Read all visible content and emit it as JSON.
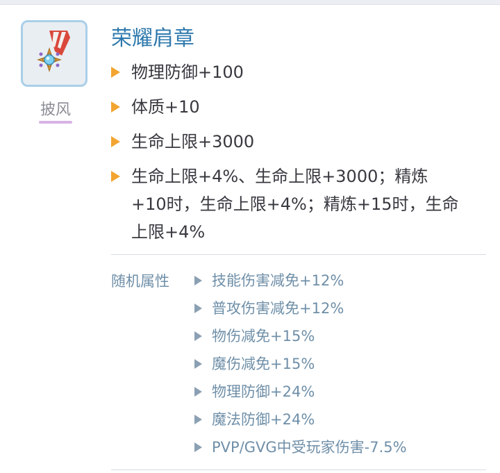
{
  "item": {
    "icon": "shoulder-medal-icon",
    "category": "披风",
    "name": "荣耀肩章"
  },
  "stats": [
    "物理防御+100",
    "体质+10",
    "生命上限+3000",
    [
      "生命上限+4%、生命上限+3000；精炼",
      "+10时，生命上限+4%；精炼+15时，生命",
      "上限+4%"
    ]
  ],
  "random_attributes": {
    "label": "随机属性",
    "items": [
      "技能伤害减免+12%",
      "普攻伤害减免+12%",
      "物伤减免+15%",
      "魔伤减免+15%",
      "物理防御+24%",
      "魔法防御+24%",
      "PVP/GVG中受玩家伤害-7.5%"
    ]
  },
  "colors": {
    "name": "#2e79ad",
    "stat_bullet": "#f2a531",
    "random_text": "#6f8fa8",
    "icon_border": "#a9cfe9"
  }
}
